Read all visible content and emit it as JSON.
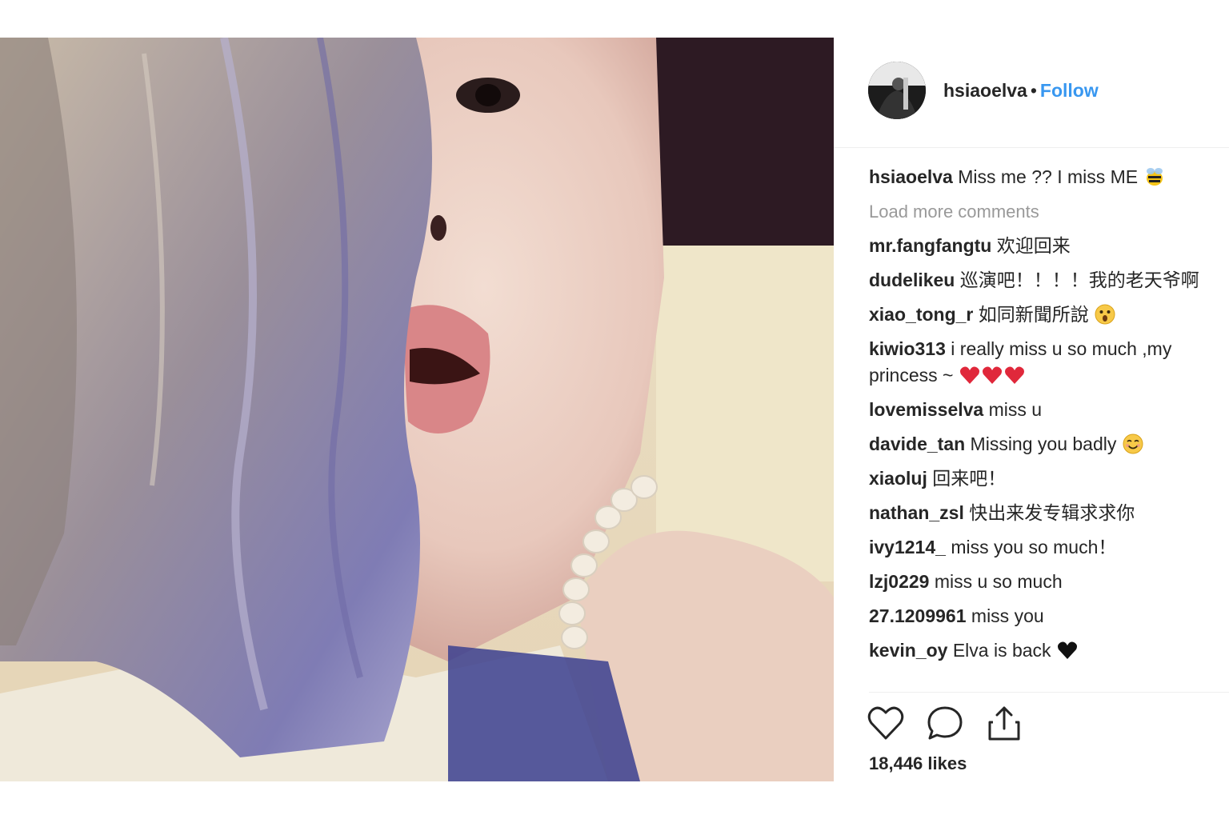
{
  "post": {
    "author": "hsiaoelva",
    "separator": "•",
    "follow_label": "Follow",
    "caption_user": "hsiaoelva",
    "caption_text": "Miss me ?? I miss ME",
    "caption_emoji": "bee-emoji",
    "load_more_label": "Load more comments",
    "likes": "18,446 likes"
  },
  "comments": [
    {
      "user": "mr.fangfangtu",
      "text": "欢迎回来"
    },
    {
      "user": "dudelikeu",
      "text": "巡演吧！！！！我的老天爷啊"
    },
    {
      "user": "xiao_tong_r",
      "text": "如同新聞所說",
      "emoji": "astonished-face-emoji"
    },
    {
      "user": "kiwio313",
      "text": "i really miss u so much ,my princess ~",
      "emoji": "heart-emoji x3"
    },
    {
      "user": "lovemisselva",
      "text": "miss u"
    },
    {
      "user": "davide_tan",
      "text": "Missing you badly",
      "emoji": "smiling-face-emoji"
    },
    {
      "user": "xiaoluj",
      "text": "回来吧！"
    },
    {
      "user": "nathan_zsl",
      "text": "快出来发专辑求求你"
    },
    {
      "user": "ivy1214_",
      "text": "miss you so much！"
    },
    {
      "user": "lzj0229",
      "text": "miss u so much"
    },
    {
      "user": "27.1209961",
      "text": "miss you"
    },
    {
      "user": "kevin_oy",
      "text": "Elva is back",
      "emoji": "black-heart-emoji"
    }
  ],
  "icons": {
    "like": "heart-outline-icon",
    "comment": "speech-bubble-icon",
    "share": "share-upload-icon"
  },
  "colors": {
    "follow": "#3897f0",
    "muted": "#999999",
    "text": "#262626",
    "heart": "#e0283b"
  }
}
